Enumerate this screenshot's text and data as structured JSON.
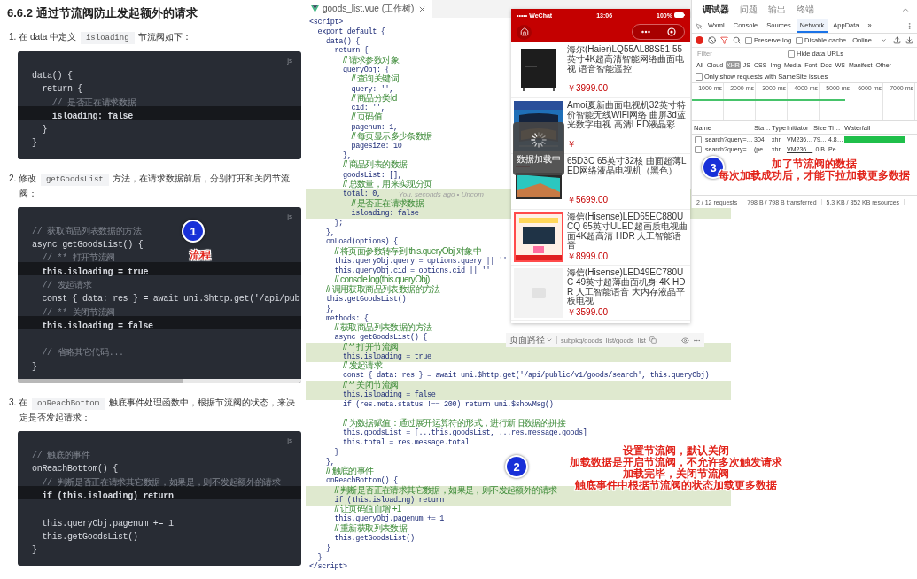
{
  "article": {
    "heading": "6.6.2 通过节流阀防止发起额外的请求",
    "steps": [
      {
        "number": "1.",
        "parts": [
          {
            "kind": "text",
            "text": "在 data 中定义 "
          },
          {
            "kind": "code",
            "text": "isloading"
          },
          {
            "kind": "text",
            "text": " 节流阀如下："
          }
        ],
        "code": {
          "language": "js",
          "scrollable": false,
          "lines": [
            {
              "text": "data() {",
              "kind": "code",
              "highlighted": false
            },
            {
              "text": "  return {",
              "kind": "code",
              "highlighted": false
            },
            {
              "text": "    // 是否正在请求数据",
              "kind": "comment",
              "highlighted": false
            },
            {
              "text": "    isloading: false",
              "kind": "code",
              "highlighted": true
            },
            {
              "text": "  }",
              "kind": "code",
              "highlighted": false
            },
            {
              "text": "}",
              "kind": "code",
              "highlighted": false
            }
          ]
        }
      },
      {
        "number": "2.",
        "parts": [
          {
            "kind": "text",
            "text": "修改 "
          },
          {
            "kind": "code",
            "text": "getGoodsList"
          },
          {
            "kind": "text",
            "text": " 方法，在请求数据前后，分别打开和关闭节流阀："
          }
        ],
        "code": {
          "language": "js",
          "scrollable": true,
          "lines": [
            {
              "text": "// 获取商品列表数据的方法",
              "kind": "comment",
              "highlighted": false
            },
            {
              "text": "async getGoodsList() {",
              "kind": "code",
              "highlighted": false
            },
            {
              "text": "  // ** 打开节流阀",
              "kind": "comment",
              "highlighted": false
            },
            {
              "text": "  this.isloading = true",
              "kind": "code",
              "highlighted": true
            },
            {
              "text": "  // 发起请求",
              "kind": "comment",
              "highlighted": false
            },
            {
              "text": "  const { data: res } = await uni.$http.get('/api/pub",
              "kind": "code",
              "highlighted": false
            },
            {
              "text": "  // ** 关闭节流阀",
              "kind": "comment",
              "highlighted": false
            },
            {
              "text": "  this.isloading = false",
              "kind": "code",
              "highlighted": true
            },
            {
              "kind": "blank",
              "highlighted": false
            },
            {
              "text": "  // 省略其它代码...",
              "kind": "comment",
              "highlighted": false
            },
            {
              "text": "}",
              "kind": "code",
              "highlighted": false
            }
          ]
        }
      },
      {
        "number": "3.",
        "parts": [
          {
            "kind": "text",
            "text": "在 "
          },
          {
            "kind": "code",
            "text": "onReachBottom"
          },
          {
            "kind": "text",
            "text": " 触底事件处理函数中，根据节流阀的状态，来决定是否发起请求："
          }
        ],
        "code": {
          "language": "js",
          "scrollable": false,
          "lines": [
            {
              "text": "// 触底的事件",
              "kind": "comment",
              "highlighted": false
            },
            {
              "text": "onReachBottom() {",
              "kind": "code",
              "highlighted": false
            },
            {
              "text": "  // 判断是否正在请求其它数据，如果是，则不发起额外的请求",
              "kind": "comment",
              "highlighted": false
            },
            {
              "text": "  if (this.isloading) return",
              "kind": "code",
              "highlighted": true
            },
            {
              "kind": "blank",
              "highlighted": false
            },
            {
              "text": "  this.queryObj.pagenum += 1",
              "kind": "code",
              "highlighted": false
            },
            {
              "text": "  this.getGoodsList()",
              "kind": "code",
              "highlighted": false
            },
            {
              "text": "}",
              "kind": "code",
              "highlighted": false
            }
          ]
        }
      }
    ]
  },
  "editor": {
    "tab": {
      "title": "goods_list.vue (工作树)"
    },
    "lines": [
      {
        "text": "<script>",
        "kind": "code",
        "highlighted": false
      },
      {
        "text": "  export default {",
        "kind": "code",
        "highlighted": false
      },
      {
        "text": "    data() {",
        "kind": "code",
        "highlighted": false
      },
      {
        "text": "      return {",
        "kind": "code",
        "highlighted": false
      },
      {
        "text": "        // 请求参数对象",
        "kind": "comment",
        "highlighted": false
      },
      {
        "text": "        queryObj: {",
        "kind": "code",
        "highlighted": false
      },
      {
        "text": "          // 查询关键词",
        "kind": "comment",
        "highlighted": false
      },
      {
        "text": "          query: '',",
        "kind": "code",
        "highlighted": false
      },
      {
        "text": "          // 商品分类Id",
        "kind": "comment",
        "highlighted": false
      },
      {
        "text": "          cid: '',",
        "kind": "code",
        "highlighted": false
      },
      {
        "text": "          // 页码值",
        "kind": "comment",
        "highlighted": false
      },
      {
        "text": "          pagenum: 1,",
        "kind": "code",
        "highlighted": false
      },
      {
        "text": "          // 每页显示多少条数据",
        "kind": "comment",
        "highlighted": false
      },
      {
        "text": "          pagesize: 10",
        "kind": "code",
        "highlighted": false
      },
      {
        "text": "        },",
        "kind": "code",
        "highlighted": false
      },
      {
        "text": "        // 商品列表的数据",
        "kind": "comment",
        "highlighted": false
      },
      {
        "text": "        goodsList: [],",
        "kind": "code",
        "highlighted": false
      },
      {
        "text": "        // 总数量，用来实现分页",
        "kind": "comment",
        "highlighted": false
      },
      {
        "text": "        total: 0,",
        "kind": "code",
        "highlighted": true,
        "blame": "You, seconds ago • Uncom"
      },
      {
        "text": "          // 是否正在请求数据",
        "kind": "comment",
        "highlighted": true
      },
      {
        "text": "          isloading: false",
        "kind": "code",
        "highlighted": true
      },
      {
        "text": "      };",
        "kind": "code",
        "highlighted": false
      },
      {
        "text": "    },",
        "kind": "code",
        "highlighted": false
      },
      {
        "text": "    onLoad(options) {",
        "kind": "code",
        "highlighted": false
      },
      {
        "text": "      // 将页面参数转存到 this.queryObj 对象中",
        "kind": "comment",
        "highlighted": false
      },
      {
        "text": "      this.queryObj.query = options.query || ''",
        "kind": "code",
        "highlighted": false
      },
      {
        "text": "      this.queryObj.cid = options.cid || ''",
        "kind": "code",
        "highlighted": false
      },
      {
        "text": "      // console.log(this.queryObj)",
        "kind": "comment",
        "highlighted": false
      },
      {
        "text": "    // 调用获取商品列表数据的方法",
        "kind": "comment",
        "highlighted": false
      },
      {
        "text": "    this.getGoodsList()",
        "kind": "code",
        "highlighted": false
      },
      {
        "text": "    },",
        "kind": "code",
        "highlighted": false
      },
      {
        "text": "    methods: {",
        "kind": "code",
        "highlighted": false
      },
      {
        "text": "      // 获取商品列表数据的方法",
        "kind": "comment",
        "highlighted": false
      },
      {
        "text": "      async getGoodsList() {",
        "kind": "code",
        "highlighted": false
      },
      {
        "text": "        // ** 打开节流阀",
        "kind": "comment",
        "highlighted": true
      },
      {
        "text": "        this.isloading = true",
        "kind": "code",
        "highlighted": true
      },
      {
        "text": "        // 发起请求",
        "kind": "comment",
        "highlighted": false
      },
      {
        "text": "        const { data: res } = await uni.$http.get('/api/public/v1/goods/search', this.queryObj)",
        "kind": "code",
        "highlighted": false
      },
      {
        "text": "        // ** 关闭节流阀",
        "kind": "comment",
        "highlighted": true
      },
      {
        "text": "        this.isloading = false",
        "kind": "code",
        "highlighted": true
      },
      {
        "text": "        if (res.meta.status !== 200) return uni.$showMsg()",
        "kind": "code",
        "highlighted": false
      },
      {
        "kind": "blank",
        "highlighted": false
      },
      {
        "text": "        // 为数据赋值：通过展开运算符的形式，进行新旧数据的拼接",
        "kind": "comment",
        "highlighted": false
      },
      {
        "text": "        this.goodsList = [...this.goodsList, ...res.message.goods]",
        "kind": "code",
        "highlighted": false
      },
      {
        "text": "        this.total = res.message.total",
        "kind": "code",
        "highlighted": false
      },
      {
        "text": "      }",
        "kind": "code",
        "highlighted": false
      },
      {
        "text": "    },",
        "kind": "code",
        "highlighted": false
      },
      {
        "text": "    // 触底的事件",
        "kind": "comment",
        "highlighted": false
      },
      {
        "text": "    onReachBottom() {",
        "kind": "code",
        "highlighted": false
      },
      {
        "text": "      // 判断是否正在请求其它数据，如果是，则不发起额外的请求",
        "kind": "comment",
        "highlighted": true
      },
      {
        "text": "      if (this.isloading) return",
        "kind": "code",
        "highlighted": true
      },
      {
        "text": "      // 让页码值自增 +1",
        "kind": "comment",
        "highlighted": false
      },
      {
        "text": "      this.queryObj.pagenum += 1",
        "kind": "code",
        "highlighted": false
      },
      {
        "text": "      // 重新获取列表数据",
        "kind": "comment",
        "highlighted": false
      },
      {
        "text": "      this.getGoodsList()",
        "kind": "code",
        "highlighted": false
      },
      {
        "text": "    }",
        "kind": "code",
        "highlighted": false
      },
      {
        "text": "  }",
        "kind": "code",
        "highlighted": false
      },
      {
        "text": "</script>",
        "kind": "code",
        "highlighted": false
      }
    ]
  },
  "phone": {
    "status_bar": {
      "carrier": "••••• WeChat",
      "time": "13:06",
      "battery": "100%"
    },
    "products": [
      {
        "title": "海尔(Haier)LQ55AL88S51 55英寸4K超高清智能网络曲面电视 语音智能遥控",
        "price": "￥3999.00",
        "kind": "picture"
      },
      {
        "title": "Amoi夏新曲面电视机32英寸特价智能无线WiFi网络 曲屏3d蓝光数字电视 高清LED液晶彩",
        "price": "￥",
        "kind": "picture"
      },
      {
        "title": "65D3C 65英寸32核 曲面超薄LED网络液晶电视机（黑色）",
        "price": "￥5699.00",
        "kind": "picture"
      },
      {
        "title": "海信(Hisense)LED65EC880UCQ 65英寸ULED超画质电视曲面4K超高清 HDR 人工智能语音",
        "price": "￥8999.00",
        "kind": "picture"
      },
      {
        "title": "海信(Hisense)LED49EC780UC 49英寸超薄曲面机身 4K HDR 人工智能语音 大内存液晶平板电视",
        "price": "￥3599.00",
        "kind": "placeholder"
      }
    ],
    "toast": "数据加载中",
    "path_bar": {
      "label": "页面路径",
      "path": "subpkg/goods_list/goods_list"
    }
  },
  "devtools": {
    "panel_tabs": [
      {
        "label": "调试器",
        "selected": true
      },
      {
        "label": "问题",
        "selected": false
      },
      {
        "label": "输出",
        "selected": false
      },
      {
        "label": "终端",
        "selected": false
      }
    ],
    "tool_tabs": [
      {
        "label": "Wxml",
        "selected": false
      },
      {
        "label": "Console",
        "selected": false
      },
      {
        "label": "Sources",
        "selected": false
      },
      {
        "label": "Network",
        "selected": true
      },
      {
        "label": "AppData",
        "selected": false
      }
    ],
    "more_tabs": "»",
    "toolbar": {
      "recording": true,
      "filter_active": true,
      "preserve_log": {
        "label": "Preserve log",
        "checked": false
      },
      "disable_cache": {
        "label": "Disable cache",
        "checked": false
      },
      "throttle": "Online"
    },
    "filter": {
      "placeholder": "Filter",
      "hide_data_urls": {
        "label": "Hide data URLs",
        "checked": false
      }
    },
    "type_filters": [
      {
        "label": "All",
        "selected": false
      },
      {
        "label": "Cloud",
        "selected": false
      },
      {
        "label": "XHR",
        "selected": true
      },
      {
        "label": "JS",
        "selected": false
      },
      {
        "label": "CSS",
        "selected": false
      },
      {
        "label": "Img",
        "selected": false
      },
      {
        "label": "Media",
        "selected": false
      },
      {
        "label": "Font",
        "selected": false
      },
      {
        "label": "Doc",
        "selected": false
      },
      {
        "label": "WS",
        "selected": false
      },
      {
        "label": "Manifest",
        "selected": false
      },
      {
        "label": "Other",
        "selected": false
      }
    ],
    "samesite": {
      "label": "Only show requests with SameSite issues",
      "checked": false
    },
    "timeline_ticks": [
      "1000 ms",
      "2000 ms",
      "3000 ms",
      "4000 ms",
      "5000 ms",
      "6000 ms",
      "7000 ms"
    ],
    "columns": [
      "Name",
      "Sta…",
      "Type",
      "Initiator",
      "Size",
      "Ti…",
      "Waterfall"
    ],
    "rows": [
      {
        "checked": false,
        "cells": [
          "search?query=…",
          "304",
          "xhr",
          "VM236…",
          "79…",
          "4.8…"
        ],
        "waterfall": true
      },
      {
        "checked": false,
        "cells": [
          "search?query=…",
          "(pe…",
          "xhr",
          "VM236…",
          "0 B",
          "Pe…"
        ],
        "waterfall": false
      }
    ],
    "summary": [
      "2 / 12 requests",
      "798 B / 798 B transferred",
      "5.3 KB / 352 KB resources"
    ]
  },
  "annotations": [
    {
      "number": "1",
      "lines": [
        "流程"
      ]
    },
    {
      "number": "2",
      "lines": [
        "设置节流阀，默认关闭",
        "加载数据是开启节流阀，不允许多次触发请求",
        "加载完毕，关闭节流阀",
        "触底事件中根据节流阀的状态加载更多数据"
      ]
    },
    {
      "number": "3",
      "lines": [
        "加了节流阀的数据",
        "每次加载成功后，才能下拉加载更多数据"
      ]
    }
  ]
}
